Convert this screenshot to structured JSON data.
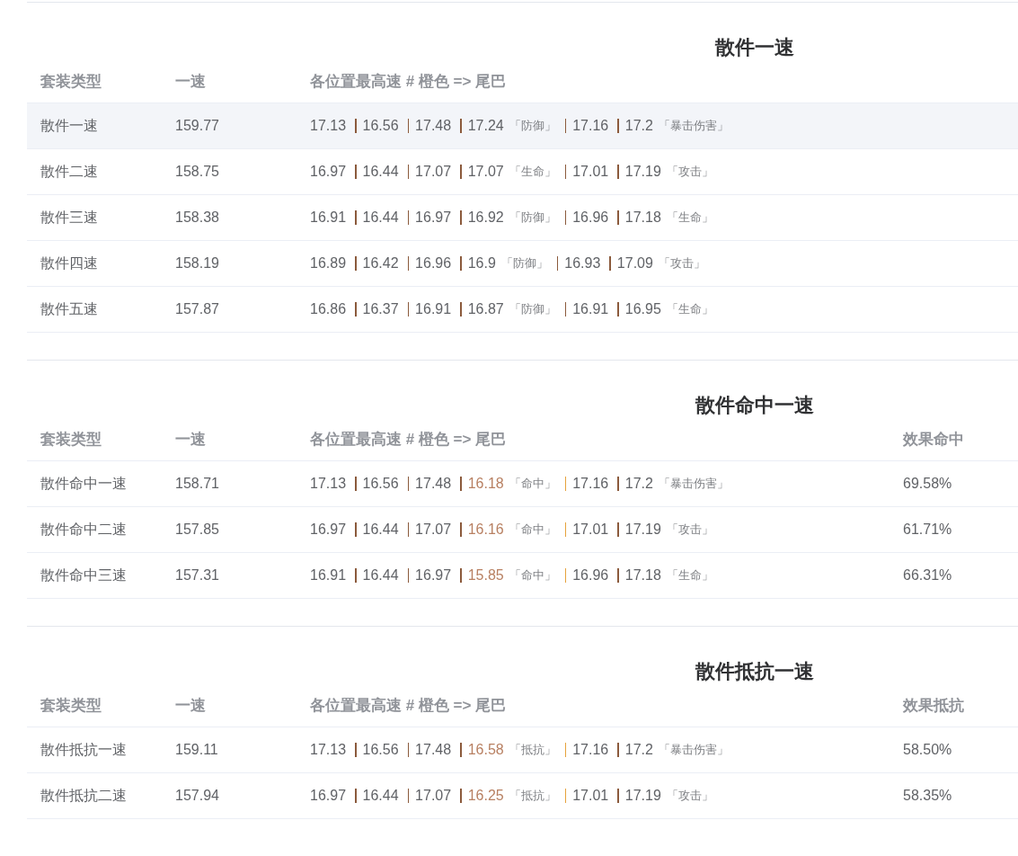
{
  "sections": [
    {
      "title": "散件一速",
      "columns": [
        "套装类型",
        "一速",
        "各位置最高速 # 橙色 => 尾巴"
      ],
      "rows": [
        {
          "name": "散件一速",
          "speed": "159.77",
          "hovered": true,
          "positions": [
            {
              "value": "17.13",
              "highlight": false
            },
            {
              "value": "16.56",
              "highlight": false
            },
            {
              "value": "17.48",
              "highlight": false
            },
            {
              "value": "17.24",
              "tag": "「防御」",
              "highlight": false
            },
            {
              "value": "17.16",
              "highlight": false
            },
            {
              "value": "17.2",
              "tag": "「暴击伤害」",
              "highlight": false
            }
          ]
        },
        {
          "name": "散件二速",
          "speed": "158.75",
          "hovered": false,
          "positions": [
            {
              "value": "16.97",
              "highlight": false
            },
            {
              "value": "16.44",
              "highlight": false
            },
            {
              "value": "17.07",
              "highlight": false
            },
            {
              "value": "17.07",
              "tag": "「生命」",
              "highlight": false
            },
            {
              "value": "17.01",
              "highlight": false
            },
            {
              "value": "17.19",
              "tag": "「攻击」",
              "highlight": false
            }
          ]
        },
        {
          "name": "散件三速",
          "speed": "158.38",
          "hovered": false,
          "positions": [
            {
              "value": "16.91",
              "highlight": false
            },
            {
              "value": "16.44",
              "highlight": false
            },
            {
              "value": "16.97",
              "highlight": false
            },
            {
              "value": "16.92",
              "tag": "「防御」",
              "highlight": false
            },
            {
              "value": "16.96",
              "highlight": false
            },
            {
              "value": "17.18",
              "tag": "「生命」",
              "highlight": false
            }
          ]
        },
        {
          "name": "散件四速",
          "speed": "158.19",
          "hovered": false,
          "positions": [
            {
              "value": "16.89",
              "highlight": false
            },
            {
              "value": "16.42",
              "highlight": false
            },
            {
              "value": "16.96",
              "highlight": false
            },
            {
              "value": "16.9",
              "tag": "「防御」",
              "highlight": false
            },
            {
              "value": "16.93",
              "highlight": false
            },
            {
              "value": "17.09",
              "tag": "「攻击」",
              "highlight": false
            }
          ]
        },
        {
          "name": "散件五速",
          "speed": "157.87",
          "hovered": false,
          "positions": [
            {
              "value": "16.86",
              "highlight": false
            },
            {
              "value": "16.37",
              "highlight": false
            },
            {
              "value": "16.91",
              "highlight": false
            },
            {
              "value": "16.87",
              "tag": "「防御」",
              "highlight": false
            },
            {
              "value": "16.91",
              "highlight": false
            },
            {
              "value": "16.95",
              "tag": "「生命」",
              "highlight": false
            }
          ]
        }
      ]
    },
    {
      "title": "散件命中一速",
      "columns": [
        "套装类型",
        "一速",
        "各位置最高速 # 橙色 => 尾巴",
        "效果命中"
      ],
      "rows": [
        {
          "name": "散件命中一速",
          "speed": "158.71",
          "hovered": false,
          "extra": "69.58%",
          "positions": [
            {
              "value": "17.13",
              "highlight": false
            },
            {
              "value": "16.56",
              "highlight": false
            },
            {
              "value": "17.48",
              "highlight": false
            },
            {
              "value": "16.18",
              "tag": "「命中」",
              "highlight": true
            },
            {
              "value": "17.16",
              "highlight": false
            },
            {
              "value": "17.2",
              "tag": "「暴击伤害」",
              "highlight": false
            }
          ]
        },
        {
          "name": "散件命中二速",
          "speed": "157.85",
          "hovered": false,
          "extra": "61.71%",
          "positions": [
            {
              "value": "16.97",
              "highlight": false
            },
            {
              "value": "16.44",
              "highlight": false
            },
            {
              "value": "17.07",
              "highlight": false
            },
            {
              "value": "16.16",
              "tag": "「命中」",
              "highlight": true
            },
            {
              "value": "17.01",
              "highlight": false
            },
            {
              "value": "17.19",
              "tag": "「攻击」",
              "highlight": false
            }
          ]
        },
        {
          "name": "散件命中三速",
          "speed": "157.31",
          "hovered": false,
          "extra": "66.31%",
          "positions": [
            {
              "value": "16.91",
              "highlight": false
            },
            {
              "value": "16.44",
              "highlight": false
            },
            {
              "value": "16.97",
              "highlight": false
            },
            {
              "value": "15.85",
              "tag": "「命中」",
              "highlight": true
            },
            {
              "value": "16.96",
              "highlight": false
            },
            {
              "value": "17.18",
              "tag": "「生命」",
              "highlight": false
            }
          ]
        }
      ]
    },
    {
      "title": "散件抵抗一速",
      "columns": [
        "套装类型",
        "一速",
        "各位置最高速 # 橙色 => 尾巴",
        "效果抵抗"
      ],
      "rows": [
        {
          "name": "散件抵抗一速",
          "speed": "159.11",
          "hovered": false,
          "extra": "58.50%",
          "positions": [
            {
              "value": "17.13",
              "highlight": false
            },
            {
              "value": "16.56",
              "highlight": false
            },
            {
              "value": "17.48",
              "highlight": false
            },
            {
              "value": "16.58",
              "tag": "「抵抗」",
              "highlight": true
            },
            {
              "value": "17.16",
              "highlight": false
            },
            {
              "value": "17.2",
              "tag": "「暴击伤害」",
              "highlight": false
            }
          ]
        },
        {
          "name": "散件抵抗二速",
          "speed": "157.94",
          "hovered": false,
          "extra": "58.35%",
          "positions": [
            {
              "value": "16.97",
              "highlight": false
            },
            {
              "value": "16.44",
              "highlight": false
            },
            {
              "value": "17.07",
              "highlight": false
            },
            {
              "value": "16.25",
              "tag": "「抵抗」",
              "highlight": true
            },
            {
              "value": "17.01",
              "highlight": false
            },
            {
              "value": "17.19",
              "tag": "「攻击」",
              "highlight": false
            }
          ]
        }
      ]
    }
  ]
}
